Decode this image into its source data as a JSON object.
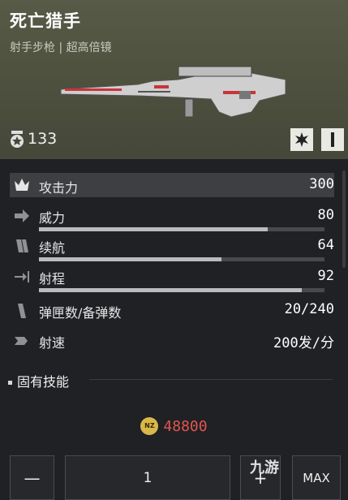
{
  "header": {
    "title": "死亡猎手",
    "subtitle": "射手步枪 | 超高倍镜",
    "level": "133"
  },
  "stats": [
    {
      "label": "攻击力",
      "value": "300",
      "icon": "crown-icon"
    },
    {
      "label": "威力",
      "value": "80",
      "icon": "arrow-right-icon",
      "bar": 0.8
    },
    {
      "label": "续航",
      "value": "64",
      "icon": "magazine-icon",
      "bar": 0.64
    },
    {
      "label": "射程",
      "value": "92",
      "icon": "range-icon",
      "bar": 0.92
    },
    {
      "label": "弹匣数/备弹数",
      "value": "20/240",
      "icon": "ammo-icon"
    },
    {
      "label": "射速",
      "value": "200发/分",
      "icon": "speed-icon"
    }
  ],
  "skills": {
    "title": "固有技能"
  },
  "price": {
    "coin": "NZ",
    "value": "48800"
  },
  "quantity": {
    "minus": "—",
    "value": "1",
    "plus": "+",
    "max": "MAX"
  },
  "watermark": "九游",
  "colors": {
    "header_bg": "#4c4f3d",
    "panel_bg": "#1f2124",
    "price": "#e3554f",
    "coin": "#d9b84a"
  }
}
